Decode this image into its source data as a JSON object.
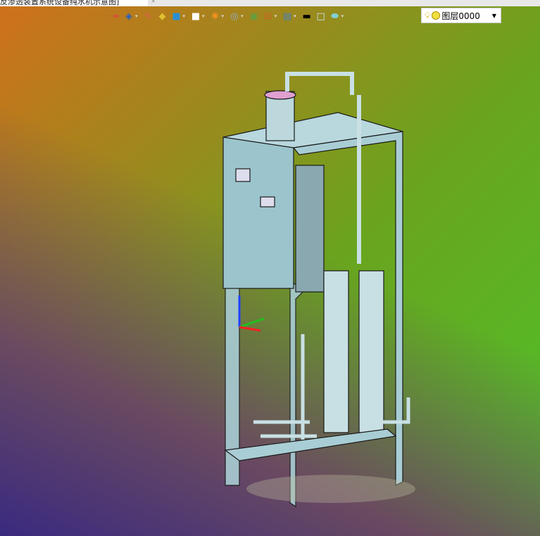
{
  "tab": {
    "title": "反渗透装置系统设备纯水机示意图]",
    "close": "×"
  },
  "toolbar": {
    "items": [
      {
        "icon": "exit-icon",
        "glyph": "⇥",
        "color": "#e04040",
        "dropdown": false
      },
      {
        "icon": "view-icon",
        "glyph": "◈",
        "color": "#2060c0",
        "dropdown": true
      },
      {
        "icon": "brush-icon",
        "glyph": "✎",
        "color": "#e06050",
        "dropdown": false
      },
      {
        "icon": "shade-icon",
        "glyph": "◆",
        "color": "#e0c030",
        "dropdown": false
      },
      {
        "icon": "cube-icon",
        "glyph": "■",
        "color": "#2a90d0",
        "dropdown": true
      },
      {
        "icon": "white-cube-icon",
        "glyph": "■",
        "color": "#ffffff",
        "dropdown": true
      },
      {
        "icon": "section-icon",
        "glyph": "✺",
        "color": "#f09020",
        "dropdown": true
      },
      {
        "icon": "zoom-icon",
        "glyph": "◎",
        "color": "#90b0d0",
        "dropdown": true
      },
      {
        "icon": "fit-icon",
        "glyph": "▣",
        "color": "#60a040",
        "dropdown": false
      },
      {
        "icon": "dimension-icon",
        "glyph": "⊟",
        "color": "#d06020",
        "dropdown": true
      },
      {
        "icon": "display-icon",
        "glyph": "▤",
        "color": "#4080c0",
        "dropdown": true
      },
      {
        "icon": "line-icon",
        "glyph": "▬",
        "color": "#000000",
        "dropdown": false
      },
      {
        "icon": "fill-color-icon",
        "glyph": "□",
        "color": "#c8e4f8",
        "dropdown": false
      },
      {
        "icon": "layer-surface-icon",
        "glyph": "⬬",
        "color": "#80d0d0",
        "dropdown": true
      }
    ]
  },
  "layer": {
    "name": "图层0000",
    "dropdown": "▼"
  },
  "colors": {
    "frame": "#a9cdd4",
    "outline": "#1a1a1a"
  }
}
